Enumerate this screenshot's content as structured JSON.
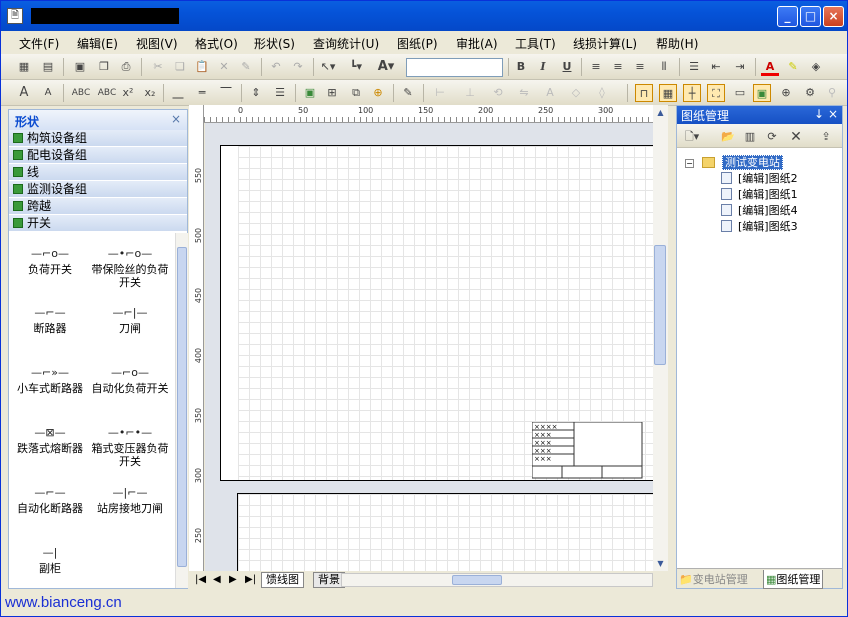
{
  "window": {
    "icon_glyph": "🗎"
  },
  "title_controls": {
    "min": "_",
    "max": "□",
    "close": "×"
  },
  "menu": [
    "文件(F)",
    "编辑(E)",
    "视图(V)",
    "格式(O)",
    "形状(S)",
    "查询统计(U)",
    "图纸(P)",
    "审批(A)",
    "工具(T)",
    "线损计算(L)",
    "帮助(H)"
  ],
  "toolbar2": {
    "bold": "B",
    "italic": "I",
    "underline": "U",
    "font_color": "A"
  },
  "toolbar3": {
    "increase_font": "A",
    "decrease_font": "A",
    "abc1": "ABC",
    "abc2": "ABC"
  },
  "shapes_panel": {
    "title": "形状",
    "close": "×",
    "categories": [
      "构筑设备组",
      "配电设备组",
      "线",
      "监测设备组",
      "跨越",
      "开关"
    ],
    "shapes": [
      {
        "symbol": "—⌐o—",
        "label": "负荷开关"
      },
      {
        "symbol": "—•⌐o—",
        "label": "带保险丝的负荷开关"
      },
      {
        "symbol": "—⌐—",
        "label": "断路器"
      },
      {
        "symbol": "—⌐|—",
        "label": "刀闸"
      },
      {
        "symbol": "—⌐»—",
        "label": "小车式断路器"
      },
      {
        "symbol": "—⌐o—",
        "label": "自动化负荷开关"
      },
      {
        "symbol": "—⊠—",
        "label": "跌落式熔断器"
      },
      {
        "symbol": "—•⌐•—",
        "label": "箱式变压器负荷开关"
      },
      {
        "symbol": "—⌐—",
        "label": "自动化断路器"
      },
      {
        "symbol": "—|⌐—",
        "label": "站房接地刀闸"
      },
      {
        "symbol": "—|",
        "label": "副柜"
      }
    ]
  },
  "ruler_top": [
    "0",
    "50",
    "100",
    "150",
    "200",
    "250",
    "300"
  ],
  "ruler_left": [
    "550",
    "500",
    "450",
    "400",
    "350",
    "300",
    "250"
  ],
  "bottom_tabs": [
    "馈线图",
    "背景"
  ],
  "nav": [
    "|◀",
    "◀",
    "▶",
    "▶|"
  ],
  "right_panel": {
    "title": "图纸管理",
    "pin": "↓",
    "close": "×",
    "tree_root": "测试变电站",
    "tree_items": [
      "[编辑]图纸2",
      "[编辑]图纸1",
      "[编辑]图纸4",
      "[编辑]图纸3"
    ],
    "tabs": [
      "变电站管理",
      "图纸管理"
    ]
  },
  "watermark": "www.bianceng.cn"
}
